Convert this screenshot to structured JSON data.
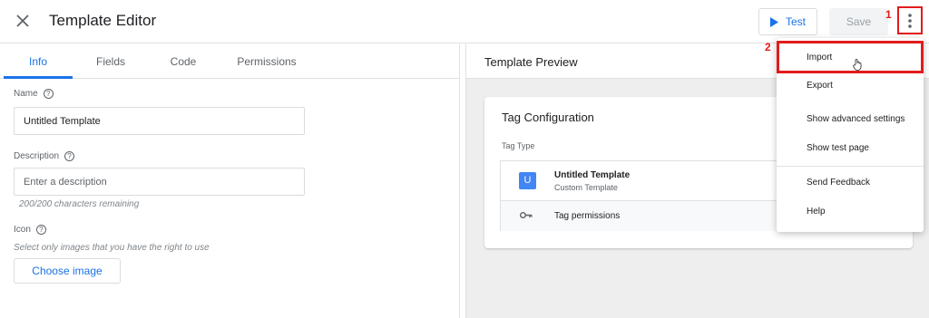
{
  "header": {
    "title": "Template Editor",
    "test_label": "Test",
    "save_label": "Save",
    "annotation_1": "1",
    "annotation_2": "2"
  },
  "tabs": [
    {
      "label": "Info",
      "active": true
    },
    {
      "label": "Fields",
      "active": false
    },
    {
      "label": "Code",
      "active": false
    },
    {
      "label": "Permissions",
      "active": false
    }
  ],
  "form": {
    "name_label": "Name",
    "name_value": "Untitled Template",
    "description_label": "Description",
    "description_placeholder": "Enter a description",
    "chars_remaining": "200/200 characters remaining",
    "icon_label": "Icon",
    "icon_hint": "Select only images that you have the right to use",
    "choose_image_label": "Choose image"
  },
  "preview": {
    "title": "Template Preview",
    "card_title": "Tag Configuration",
    "tag_type_label": "Tag Type",
    "tag_letter": "U",
    "tag_name": "Untitled Template",
    "tag_subtitle": "Custom Template",
    "tag_permissions": "Tag permissions"
  },
  "menu": {
    "items": [
      {
        "label": "Import",
        "highlighted": true
      },
      {
        "label": "Export"
      },
      {
        "label": "Show advanced settings"
      },
      {
        "label": "Show test page"
      },
      {
        "label": "Send Feedback"
      },
      {
        "label": "Help"
      }
    ]
  },
  "colors": {
    "accent": "#1a73e8",
    "annotation": "#e21c1c",
    "tag_badge": "#4285f4"
  },
  "icons": {
    "close": "close-icon",
    "test": "play-icon",
    "more": "more-vert-icon",
    "help": "help-circle-icon",
    "key": "key-icon",
    "cursor": "hand-pointer-icon"
  }
}
